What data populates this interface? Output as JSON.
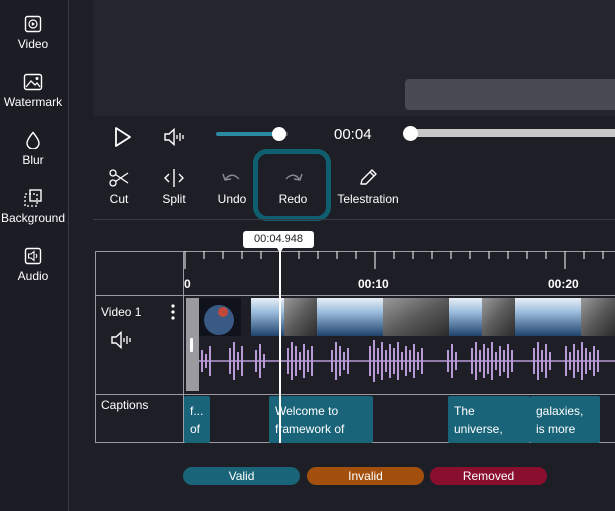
{
  "sidebar": {
    "items": [
      {
        "label": "Video",
        "icon": "video-icon"
      },
      {
        "label": "Watermark",
        "icon": "watermark-icon"
      },
      {
        "label": "Blur",
        "icon": "blur-icon"
      },
      {
        "label": "Background",
        "icon": "background-icon"
      },
      {
        "label": "Audio",
        "icon": "audio-icon"
      }
    ]
  },
  "player": {
    "current_time": "00:04",
    "volume_level": 0.85,
    "seek_progress": 0.0
  },
  "toolbar": {
    "cut_label": "Cut",
    "split_label": "Split",
    "undo_label": "Undo",
    "redo_label": "Redo",
    "telestration_label": "Telestration",
    "highlighted": "redo"
  },
  "timeline": {
    "playhead_time": "00:04.948",
    "ruler_labels": [
      "0",
      "00:10",
      "00:20"
    ],
    "tracks": {
      "video_label": "Video 1",
      "captions_label": "Captions"
    },
    "captions": [
      {
        "text": "f... of"
      },
      {
        "text": "Welcome to framework of"
      },
      {
        "text": "The universe,"
      },
      {
        "text": "galaxies, is more"
      }
    ]
  },
  "legend": {
    "valid": "Valid",
    "invalid": "Invalid",
    "removed": "Removed"
  },
  "colors": {
    "accent": "#196478",
    "valid": "#196478",
    "invalid": "#a3500f",
    "removed": "#8a0f2f",
    "waveform": "#b79ad6"
  }
}
